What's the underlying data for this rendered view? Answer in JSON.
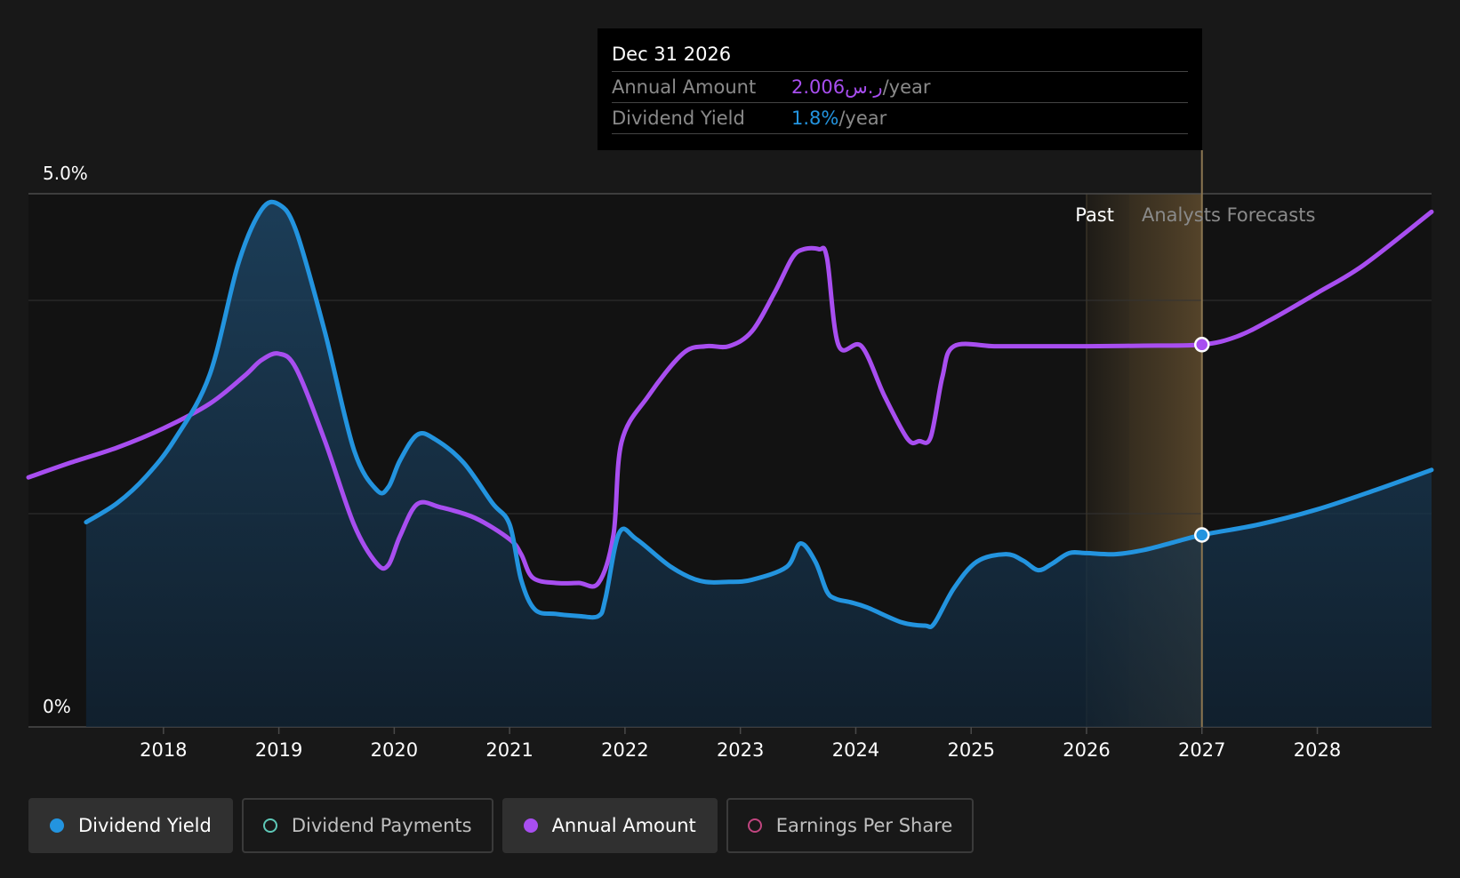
{
  "tooltip": {
    "date": "Dec 31 2026",
    "annual_label": "Annual Amount",
    "annual_value": "2.006ر.س",
    "annual_unit": "/year",
    "yield_label": "Dividend Yield",
    "yield_value": "1.8%",
    "yield_unit": "/year"
  },
  "legend": [
    {
      "label": "Dividend Yield",
      "color": "#2394df",
      "style": "filled",
      "active": true
    },
    {
      "label": "Dividend Payments",
      "color": "#5ec8b7",
      "style": "hollow",
      "active": false
    },
    {
      "label": "Annual Amount",
      "color": "#a84ef0",
      "style": "filled",
      "active": true
    },
    {
      "label": "Earnings Per Share",
      "color": "#c0457f",
      "style": "hollow",
      "active": false
    }
  ],
  "chart_data": {
    "type": "line",
    "y_top_label": "5.0%",
    "y_bottom_label": "0%",
    "ylim": [
      0,
      5.0
    ],
    "xlim": [
      2016.83,
      2028.99
    ],
    "x_ticks": [
      "2018",
      "2019",
      "2020",
      "2021",
      "2022",
      "2023",
      "2024",
      "2025",
      "2026",
      "2027",
      "2028"
    ],
    "region_past_label": "Past",
    "region_forecast_label": "Analysts Forecasts",
    "past_start": 2026.0,
    "forecast_start": 2027.0,
    "series": [
      {
        "name": "Dividend Yield",
        "color": "#2394df",
        "x": [
          2017.33,
          2017.6,
          2017.85,
          2018.1,
          2018.4,
          2018.65,
          2018.85,
          2019.0,
          2019.15,
          2019.4,
          2019.65,
          2019.85,
          2019.95,
          2020.05,
          2020.2,
          2020.35,
          2020.6,
          2020.85,
          2021.0,
          2021.1,
          2021.22,
          2021.4,
          2021.6,
          2021.77,
          2021.83,
          2021.95,
          2022.1,
          2022.4,
          2022.65,
          2022.9,
          2023.1,
          2023.4,
          2023.52,
          2023.65,
          2023.75,
          2023.83,
          2023.95,
          2024.1,
          2024.4,
          2024.6,
          2024.68,
          2024.85,
          2025.05,
          2025.3,
          2025.45,
          2025.58,
          2025.7,
          2025.85,
          2026.0,
          2026.25,
          2026.5,
          2026.75,
          2027.0,
          2027.5,
          2028.0,
          2028.5,
          2028.99
        ],
        "values": [
          1.92,
          2.1,
          2.35,
          2.7,
          3.3,
          4.35,
          4.85,
          4.9,
          4.65,
          3.7,
          2.6,
          2.22,
          2.25,
          2.5,
          2.74,
          2.7,
          2.48,
          2.1,
          1.9,
          1.38,
          1.1,
          1.06,
          1.04,
          1.04,
          1.2,
          1.82,
          1.76,
          1.5,
          1.37,
          1.36,
          1.38,
          1.5,
          1.72,
          1.55,
          1.27,
          1.2,
          1.17,
          1.12,
          0.98,
          0.95,
          0.97,
          1.3,
          1.55,
          1.62,
          1.56,
          1.47,
          1.53,
          1.63,
          1.63,
          1.62,
          1.66,
          1.73,
          1.8,
          1.9,
          2.04,
          2.22,
          2.41
        ]
      },
      {
        "name": "Annual Amount",
        "color": "#a84ef0",
        "x": [
          2016.83,
          2017.2,
          2017.6,
          2018.0,
          2018.4,
          2018.7,
          2018.85,
          2019.0,
          2019.15,
          2019.4,
          2019.65,
          2019.85,
          2019.95,
          2020.05,
          2020.2,
          2020.4,
          2020.7,
          2021.0,
          2021.1,
          2021.2,
          2021.4,
          2021.6,
          2021.77,
          2021.9,
          2021.97,
          2022.2,
          2022.5,
          2022.7,
          2022.9,
          2023.1,
          2023.3,
          2023.45,
          2023.55,
          2023.68,
          2023.75,
          2023.85,
          2024.05,
          2024.25,
          2024.45,
          2024.55,
          2024.65,
          2024.75,
          2024.85,
          2025.2,
          2025.5,
          2025.8,
          2026.0,
          2026.5,
          2027.0,
          2027.3,
          2027.6,
          2028.0,
          2028.4,
          2028.99
        ],
        "values": [
          2.34,
          2.48,
          2.62,
          2.8,
          3.03,
          3.29,
          3.44,
          3.5,
          3.36,
          2.68,
          1.9,
          1.53,
          1.52,
          1.79,
          2.09,
          2.06,
          1.96,
          1.76,
          1.62,
          1.4,
          1.35,
          1.35,
          1.35,
          1.8,
          2.67,
          3.1,
          3.5,
          3.57,
          3.57,
          3.71,
          4.08,
          4.4,
          4.48,
          4.48,
          4.4,
          3.58,
          3.57,
          3.1,
          2.7,
          2.68,
          2.72,
          3.28,
          3.57,
          3.57,
          3.57,
          3.57,
          3.57,
          3.575,
          3.585,
          3.66,
          3.82,
          4.07,
          4.33,
          4.83
        ]
      }
    ],
    "markers": [
      {
        "series": "Annual Amount",
        "x": 2027.0,
        "y": 3.585
      },
      {
        "series": "Dividend Yield",
        "x": 2027.0,
        "y": 1.8
      }
    ]
  }
}
